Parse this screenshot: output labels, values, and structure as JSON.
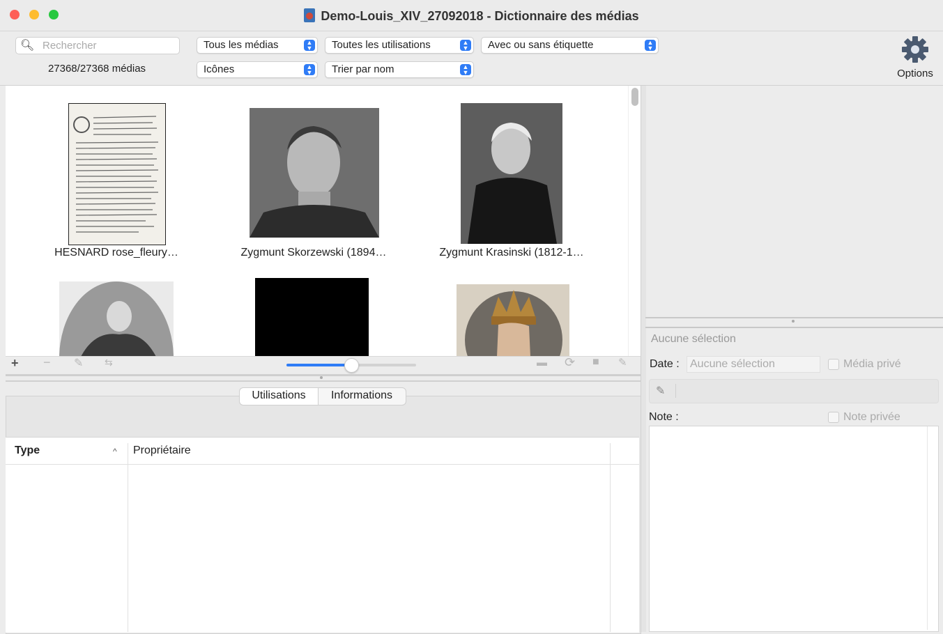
{
  "window": {
    "title": "Demo-Louis_XIV_27092018 - Dictionnaire des médias",
    "traffic_lights": {
      "close": "#fe5f57",
      "minimize": "#febc2e",
      "zoom": "#28c840"
    }
  },
  "toolbar": {
    "search_placeholder": "Rechercher",
    "media_count": "27368/27368 médias",
    "filter_media": "Tous les médias",
    "filter_usage": "Toutes les utilisations",
    "filter_label": "Avec ou sans étiquette",
    "view_mode": "Icônes",
    "sort_mode": "Trier par nom",
    "options_label": "Options",
    "accent_color": "#2f7cf6"
  },
  "grid": {
    "items": [
      {
        "caption": "HESNARD rose_fleury…",
        "kind": "document"
      },
      {
        "caption": "Zygmunt Skorzewski (1894…",
        "kind": "portrait"
      },
      {
        "caption": "Zygmunt Krasinski (1812-1…",
        "kind": "portrait"
      },
      {
        "caption": "",
        "kind": "portrait"
      },
      {
        "caption": "",
        "kind": "black"
      },
      {
        "caption": "",
        "kind": "crown"
      }
    ],
    "zoom_slider_value": 0.5
  },
  "bottom_tabs": {
    "tab_usages": "Utilisations",
    "tab_info": "Informations",
    "col_type": "Type",
    "col_owner": "Propriétaire"
  },
  "details": {
    "no_selection": "Aucune sélection",
    "date_label": "Date :",
    "date_placeholder": "Aucune sélection",
    "private_media": "Média privé",
    "note_label": "Note :",
    "private_note": "Note privée"
  }
}
